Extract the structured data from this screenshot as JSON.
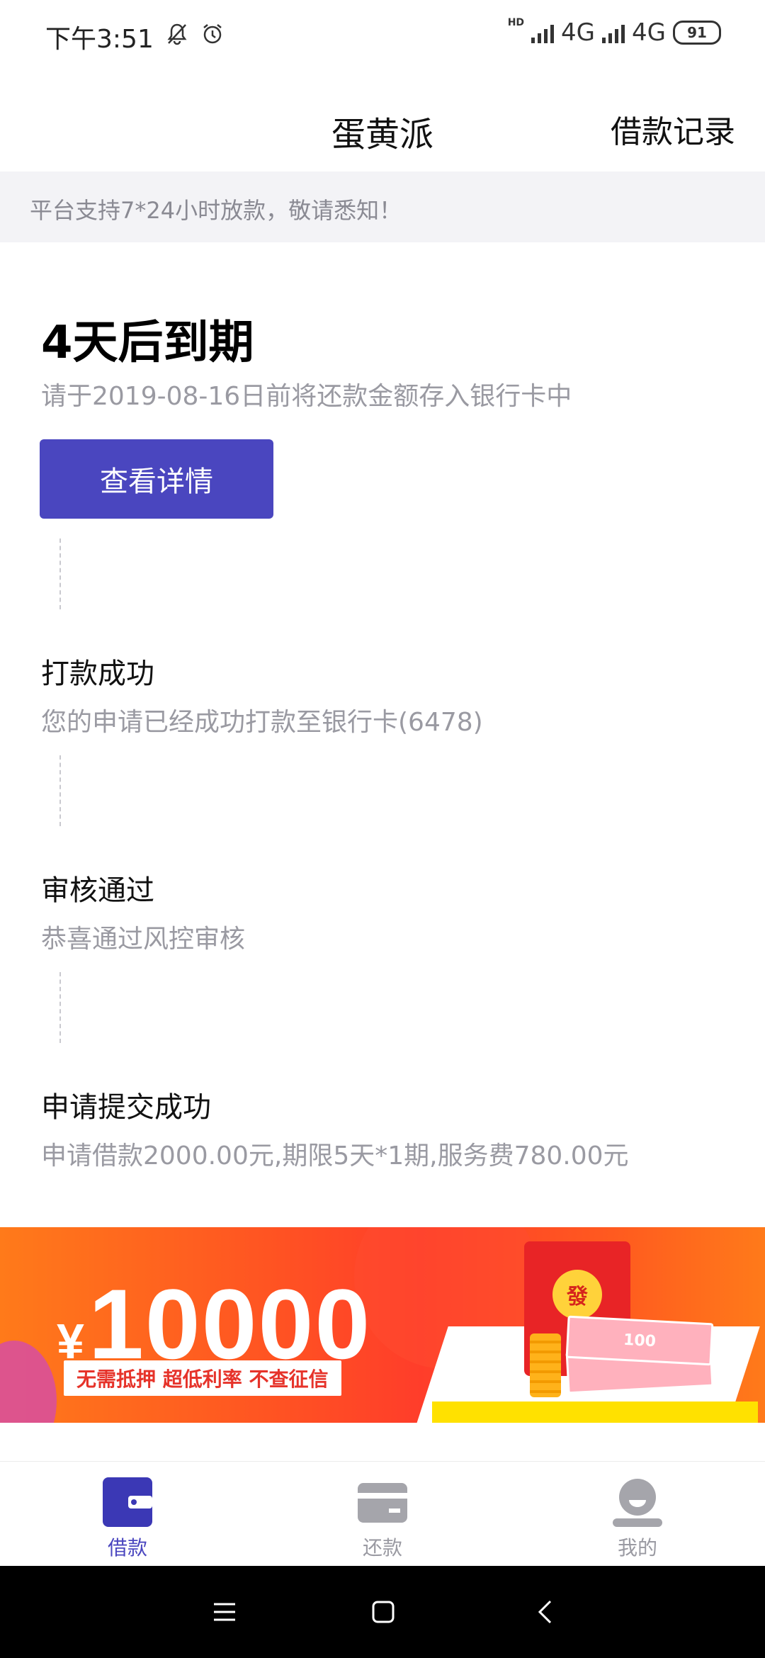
{
  "status_bar": {
    "time": "下午3:51",
    "network1": "4G",
    "network2": "4G",
    "battery": "91",
    "hd_label": "HD"
  },
  "header": {
    "title": "蛋黄派",
    "history_link": "借款记录"
  },
  "notice": "平台支持7*24小时放款，敬请悉知！",
  "due": {
    "title": "4天后到期",
    "description": "请于2019-08-16日前将还款金额存入银行卡中",
    "button_label": "查看详情"
  },
  "steps": [
    {
      "title": "打款成功",
      "description": "您的申请已经成功打款至银行卡(6478)"
    },
    {
      "title": "审核通过",
      "description": "恭喜通过风控审核"
    },
    {
      "title": "申请提交成功",
      "description": "申请借款2000.00元,期限5天*1期,服务费780.00元"
    }
  ],
  "banner": {
    "currency": "¥",
    "amount": "10000",
    "tagline": "无需抵押 超低利率 不查征信",
    "envelope_char": "發",
    "bill_value": "100"
  },
  "tabs": [
    {
      "label": "借款",
      "icon": "wallet-icon",
      "active": true
    },
    {
      "label": "还款",
      "icon": "card-icon",
      "active": false
    },
    {
      "label": "我的",
      "icon": "user-icon",
      "active": false
    }
  ],
  "colors": {
    "accent": "#4a46bf",
    "muted_text": "#9a9aa2",
    "notice_bg": "#f3f3f6",
    "banner_orange": "#ff5422"
  }
}
